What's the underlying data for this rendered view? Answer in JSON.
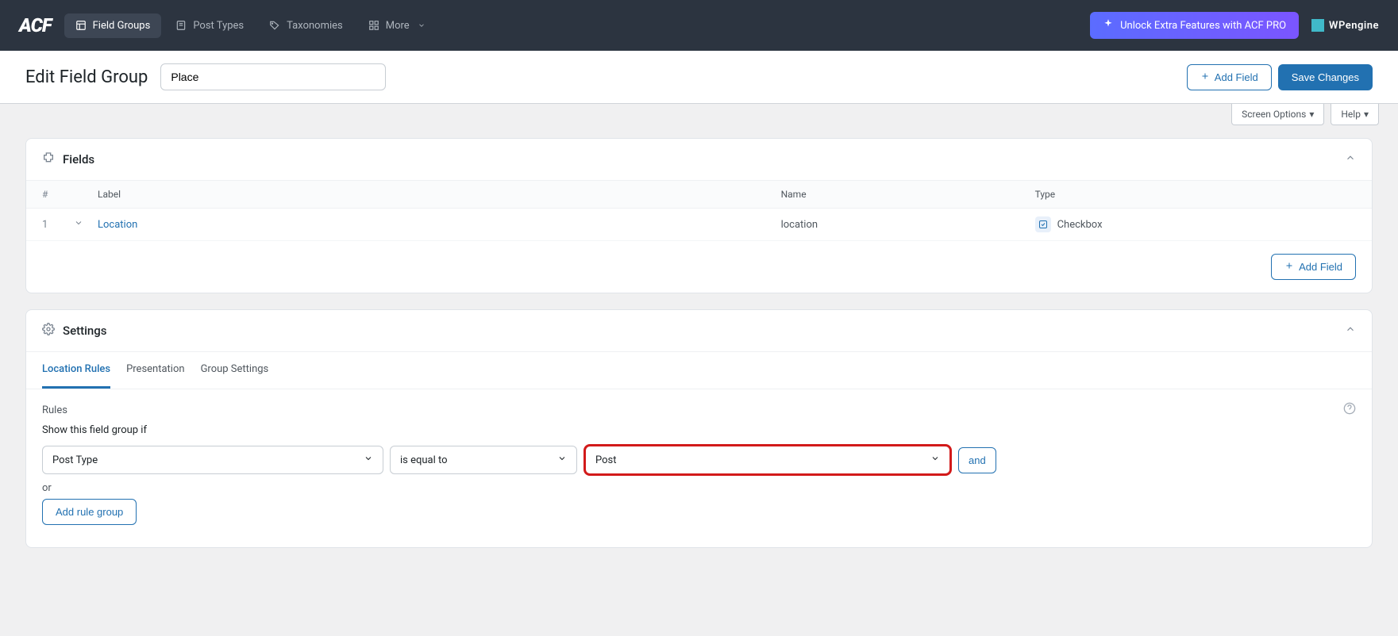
{
  "brand": "ACF",
  "nav": {
    "field_groups": "Field Groups",
    "post_types": "Post Types",
    "taxonomies": "Taxonomies",
    "more": "More"
  },
  "unlock_label": "Unlock Extra Features with ACF PRO",
  "wpengine_label": "WPengine",
  "page_title": "Edit Field Group",
  "title_value": "Place",
  "add_field_label": "Add Field",
  "save_label": "Save Changes",
  "screen_options_label": "Screen Options",
  "help_label": "Help",
  "fields_panel_title": "Fields",
  "table_headers": {
    "num": "#",
    "label": "Label",
    "name": "Name",
    "type": "Type"
  },
  "fields": [
    {
      "num": "1",
      "label": "Location",
      "name": "location",
      "type": "Checkbox"
    }
  ],
  "settings_panel_title": "Settings",
  "tabs": {
    "location_rules": "Location Rules",
    "presentation": "Presentation",
    "group_settings": "Group Settings"
  },
  "rules_heading": "Rules",
  "rules_subheading": "Show this field group if",
  "rule": {
    "param": "Post Type",
    "operator": "is equal to",
    "value": "Post"
  },
  "and_label": "and",
  "or_label": "or",
  "add_rule_group_label": "Add rule group"
}
